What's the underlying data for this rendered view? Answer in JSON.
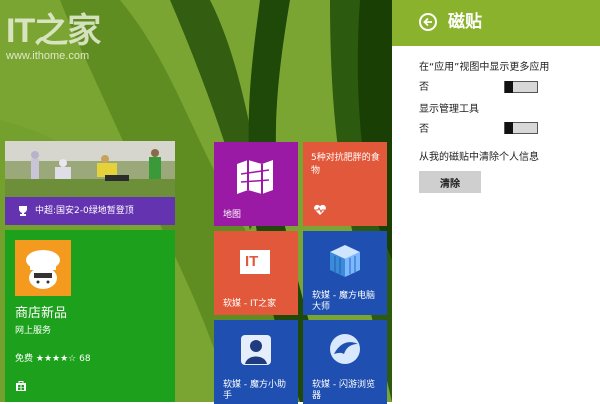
{
  "watermark": {
    "logo": "IT之家",
    "url": "www.ithome.com"
  },
  "tiles": {
    "sports": {
      "label": "中超:国安2-0绿地暂登顶",
      "icon": "trophy-icon"
    },
    "store": {
      "title": "商店新品",
      "subtitle": "网上服务",
      "price": "免费",
      "stars": "★★★★☆",
      "rating_count": "68",
      "icon": "store-icon"
    },
    "maps": {
      "label": "地图",
      "icon": "map-icon"
    },
    "health": {
      "headline": "5种对抗肥胖的食物",
      "icon": "heart-pulse-icon"
    },
    "ithome": {
      "label": "软媒 - IT之家",
      "logo_text": "IT"
    },
    "pcmaster": {
      "label": "软媒 - 魔方电脑大师",
      "icon": "cube-icon"
    },
    "helper": {
      "label": "软媒 - 魔方小助手",
      "icon": "person-icon"
    },
    "browser": {
      "label": "软媒 - 闪游浏览器",
      "icon": "bird-icon"
    }
  },
  "panel": {
    "title": "磁贴",
    "more_apps_label": "在“应用”视图中显示更多应用",
    "more_apps_value": "否",
    "admin_tools_label": "显示管理工具",
    "admin_tools_value": "否",
    "clear_info_label": "从我的磁贴中清除个人信息",
    "clear_button": "清除"
  },
  "colors": {
    "background": "#7aa533",
    "panel_header": "#8bb22c",
    "store": "#1da11d",
    "maps": "#9a1aa5",
    "orange": "#e2583a",
    "blue": "#1f4fb0",
    "sports": "#6433b0"
  }
}
